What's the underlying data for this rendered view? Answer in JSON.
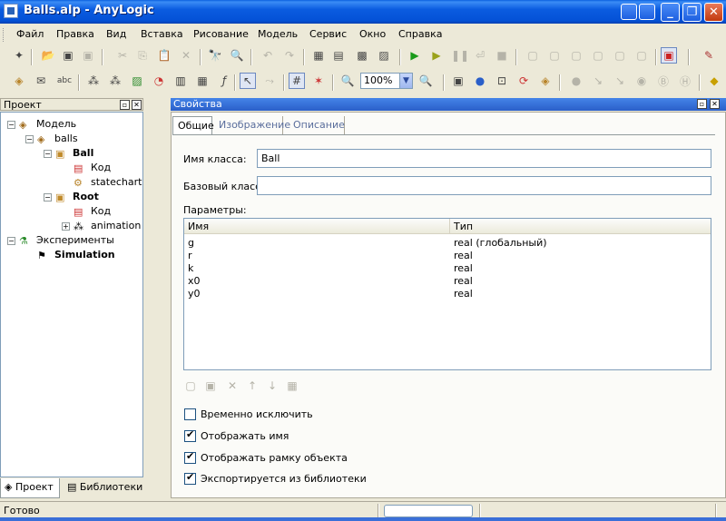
{
  "window": {
    "title": "Balls.alp - AnyLogic",
    "min_label": "_",
    "restore_label": "❐",
    "close_label": "✕"
  },
  "menu": [
    "Файл",
    "Правка",
    "Вид",
    "Вставка",
    "Рисование",
    "Модель",
    "Сервис",
    "Окно",
    "Справка"
  ],
  "toolbar": {
    "zoom_value": "100%"
  },
  "project_panel": {
    "title": "Проект",
    "tree": [
      {
        "label": "Модель",
        "bold": false
      },
      {
        "label": "balls",
        "bold": false
      },
      {
        "label": "Ball",
        "bold": true
      },
      {
        "label": "Код",
        "bold": false
      },
      {
        "label": "statechart",
        "bold": false
      },
      {
        "label": "Root",
        "bold": true
      },
      {
        "label": "Код",
        "bold": false
      },
      {
        "label": "animation",
        "bold": false
      },
      {
        "label": "Эксперименты",
        "bold": false
      },
      {
        "label": "Simulation",
        "bold": true
      }
    ],
    "tabs": [
      "Проект",
      "Библиотеки"
    ]
  },
  "properties_panel": {
    "title": "Свойства",
    "tabs": [
      "Общие",
      "Изображение",
      "Описание"
    ],
    "class_name_label": "Имя класса:",
    "class_name_value": "Ball",
    "base_class_label": "Базовый класс:",
    "base_class_value": "",
    "params_label": "Параметры:",
    "params_columns": [
      "Имя",
      "Тип"
    ],
    "params_rows": [
      {
        "name": "g",
        "type": "real (глобальный)"
      },
      {
        "name": "r",
        "type": "real"
      },
      {
        "name": "k",
        "type": "real"
      },
      {
        "name": "x0",
        "type": "real"
      },
      {
        "name": "y0",
        "type": "real"
      }
    ],
    "checkboxes": [
      {
        "label": "Временно исключить",
        "checked": false
      },
      {
        "label": "Отображать имя",
        "checked": true
      },
      {
        "label": "Отображать рамку объекта",
        "checked": true
      },
      {
        "label": "Экспортируется из библиотеки",
        "checked": true
      }
    ]
  },
  "status": {
    "text": "Готово"
  }
}
